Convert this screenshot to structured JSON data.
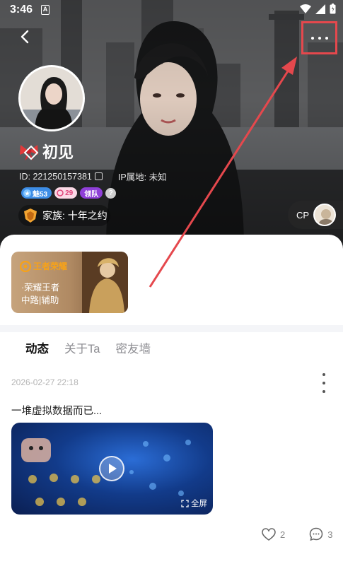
{
  "status_bar": {
    "time": "3:46",
    "notification_glyph": "A"
  },
  "profile": {
    "name": "初见",
    "id_text": "ID: 221250157381",
    "ip_text": "IP属地: 未知",
    "badges": {
      "charm": "魅53",
      "wealth": "29",
      "leader": "领队",
      "help": "?"
    },
    "family": "家族: 十年之约",
    "cp_label": "CP"
  },
  "game_card": {
    "logo_text": "王者荣耀",
    "game_name": "·荣耀王者",
    "roles": "中路|辅助"
  },
  "tabs": [
    {
      "label": "动态",
      "active": true
    },
    {
      "label": "关于Ta",
      "active": false
    },
    {
      "label": "密友墙",
      "active": false
    }
  ],
  "post": {
    "date": "2026-02-27 22:18",
    "text": "一堆虚拟数据而已...",
    "fullscreen_label": "全屏",
    "likes": "2",
    "comments": "3"
  },
  "colors": {
    "highlight_box": "#e5484d",
    "tab_accent": "#3ee0c8",
    "charm_badge": "#3d8de6",
    "leader_badge": "#8f3fd8"
  }
}
